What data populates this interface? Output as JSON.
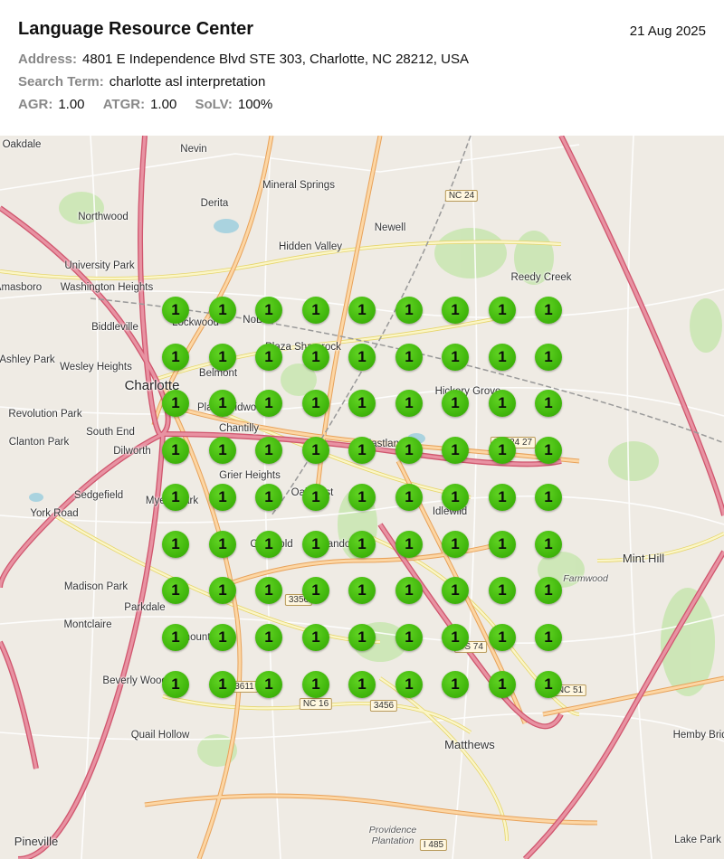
{
  "header": {
    "title": "Language Resource Center",
    "date": "21 Aug 2025",
    "address_label": "Address:",
    "address": "4801 E Independence Blvd STE 303, Charlotte, NC 28212, USA",
    "search_label": "Search Term:",
    "search_term": "charlotte asl interpretation",
    "agr_label": "AGR:",
    "agr": "1.00",
    "atgr_label": "ATGR:",
    "atgr": "1.00",
    "solv_label": "SoLV:",
    "solv": "100%"
  },
  "map": {
    "places": [
      "Oakdale",
      "Nevin",
      "Derita",
      "Mineral Springs",
      "Northwood",
      "Newell",
      "Hidden Valley",
      "University Park",
      "Washington Heights",
      "Reedy Creek",
      "Biddleville",
      "Ashley Park",
      "Wesley Heights",
      "Charlotte",
      "Belmont",
      "NoDa",
      "Plaza Shamrock",
      "Revolution Park",
      "South End",
      "Clanton Park",
      "Dilworth",
      "Chantilly",
      "Hickory Grove",
      "Sedgefield",
      "Grier Heights",
      "York Road",
      "Idlewild",
      "Mint Hill",
      "Madison Park",
      "Parkdale",
      "Montclaire",
      "Beverly Woods",
      "Quail Hollow",
      "Matthews",
      "Hemby Bridge",
      "Lake Park",
      "Pineville",
      "Farmwood",
      "Providence Plantation",
      "Eastland",
      "Cotswold",
      "Oakhurst",
      "Randolph",
      "Myers Park",
      "Plaza Midwood",
      "Lockwood",
      "Amasboro",
      "Starmount"
    ],
    "route_shields": [
      "NC 24",
      "NC 16",
      "NC 51",
      "US 74",
      "3456",
      "3356",
      "3611",
      "I 485",
      "NC 24 27"
    ],
    "colors": {
      "background": "#efebe4",
      "marker": "#42b80d",
      "motorway": "#e892a2",
      "primary": "#fcd6a4",
      "secondary": "#f7fabf",
      "park": "#c8facc"
    },
    "grid": {
      "rows": [
        [
          "1",
          "1",
          "1",
          "1",
          "1",
          "1",
          "1",
          "1",
          "1"
        ],
        [
          "1",
          "1",
          "1",
          "1",
          "1",
          "1",
          "1",
          "1",
          "1"
        ],
        [
          "1",
          "1",
          "1",
          "1",
          "1",
          "1",
          "1",
          "1",
          "1"
        ],
        [
          "1",
          "1",
          "1",
          "1",
          "1",
          "1",
          "1",
          "1",
          "1"
        ],
        [
          "1",
          "1",
          "1",
          "1",
          "1",
          "1",
          "1",
          "1",
          "1"
        ],
        [
          "1",
          "1",
          "1",
          "1",
          "1",
          "1",
          "1",
          "1",
          "1"
        ],
        [
          "1",
          "1",
          "1",
          "1",
          "1",
          "1",
          "1",
          "1",
          "1"
        ],
        [
          "1",
          "1",
          "1",
          "1",
          "1",
          "1",
          "1",
          "1",
          "1"
        ],
        [
          "1",
          "1",
          "1",
          "1",
          "1",
          "1",
          "1",
          "1",
          "1"
        ]
      ]
    }
  }
}
